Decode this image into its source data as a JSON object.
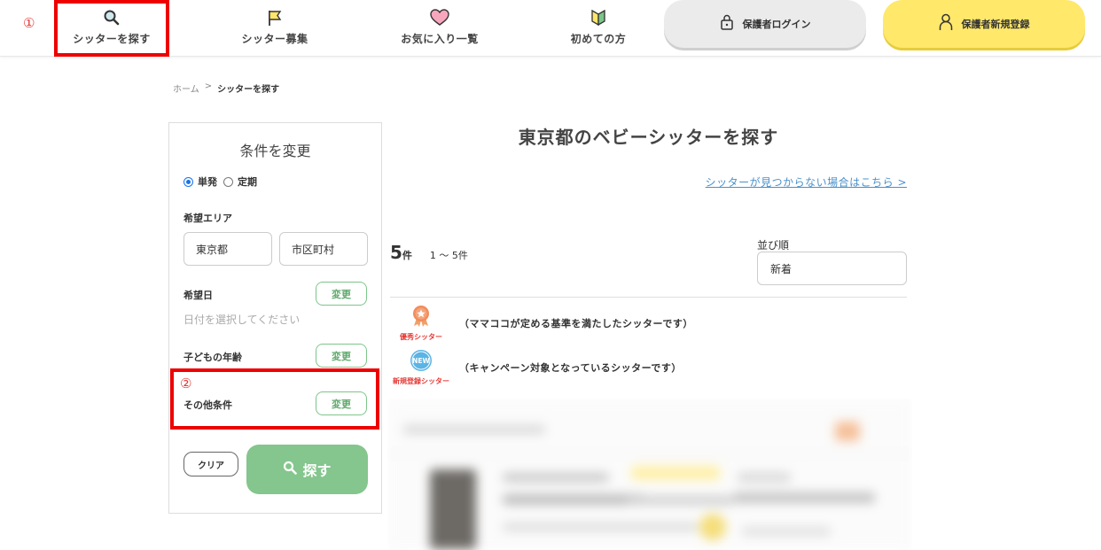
{
  "annotations": {
    "one": "①",
    "two": "②"
  },
  "nav": {
    "items": [
      {
        "label": "シッターを探す",
        "icon": "magnifier-icon"
      },
      {
        "label": "シッター募集",
        "icon": "flag-icon"
      },
      {
        "label": "お気に入り一覧",
        "icon": "heart-icon"
      },
      {
        "label": "初めての方",
        "icon": "beginner-mark-icon"
      }
    ],
    "login_label": "保護者ログイン",
    "register_label": "保護者新規登録"
  },
  "breadcrumb": {
    "home": "ホーム",
    "separator": ">",
    "current": "シッターを探す"
  },
  "sidebar": {
    "title": "条件を変更",
    "radio_single": "単発",
    "radio_regular": "定期",
    "area_label": "希望エリア",
    "prefecture_value": "東京都",
    "city_placeholder": "市区町村",
    "date_label": "希望日",
    "date_placeholder": "日付を選択してください",
    "child_age_label": "子どもの年齢",
    "other_label": "その他条件",
    "change_label": "変更",
    "clear_label": "クリア",
    "search_label": "探す"
  },
  "main": {
    "title": "東京都のベビーシッターを探す",
    "not_found_link": "シッターが見つからない場合はこちら >",
    "count_number": "5",
    "count_unit": "件",
    "count_range": "1 〜 5件",
    "sort_label": "並び順",
    "sort_value": "新着",
    "legend": [
      {
        "badge_caption": "優秀シッター",
        "text": "（ママココが定める基準を満たしたシッターです）",
        "icon": "award-medal-icon"
      },
      {
        "badge_caption": "新規登録シッター",
        "text": "（キャンペーン対象となっているシッターです）",
        "icon": "new-badge-icon",
        "badge_text": "NEW"
      }
    ]
  },
  "colors": {
    "highlight": "#ee0000",
    "accent_green": "#84c68d",
    "register_yellow": "#ffe86a",
    "link_blue": "#4a90c8"
  }
}
